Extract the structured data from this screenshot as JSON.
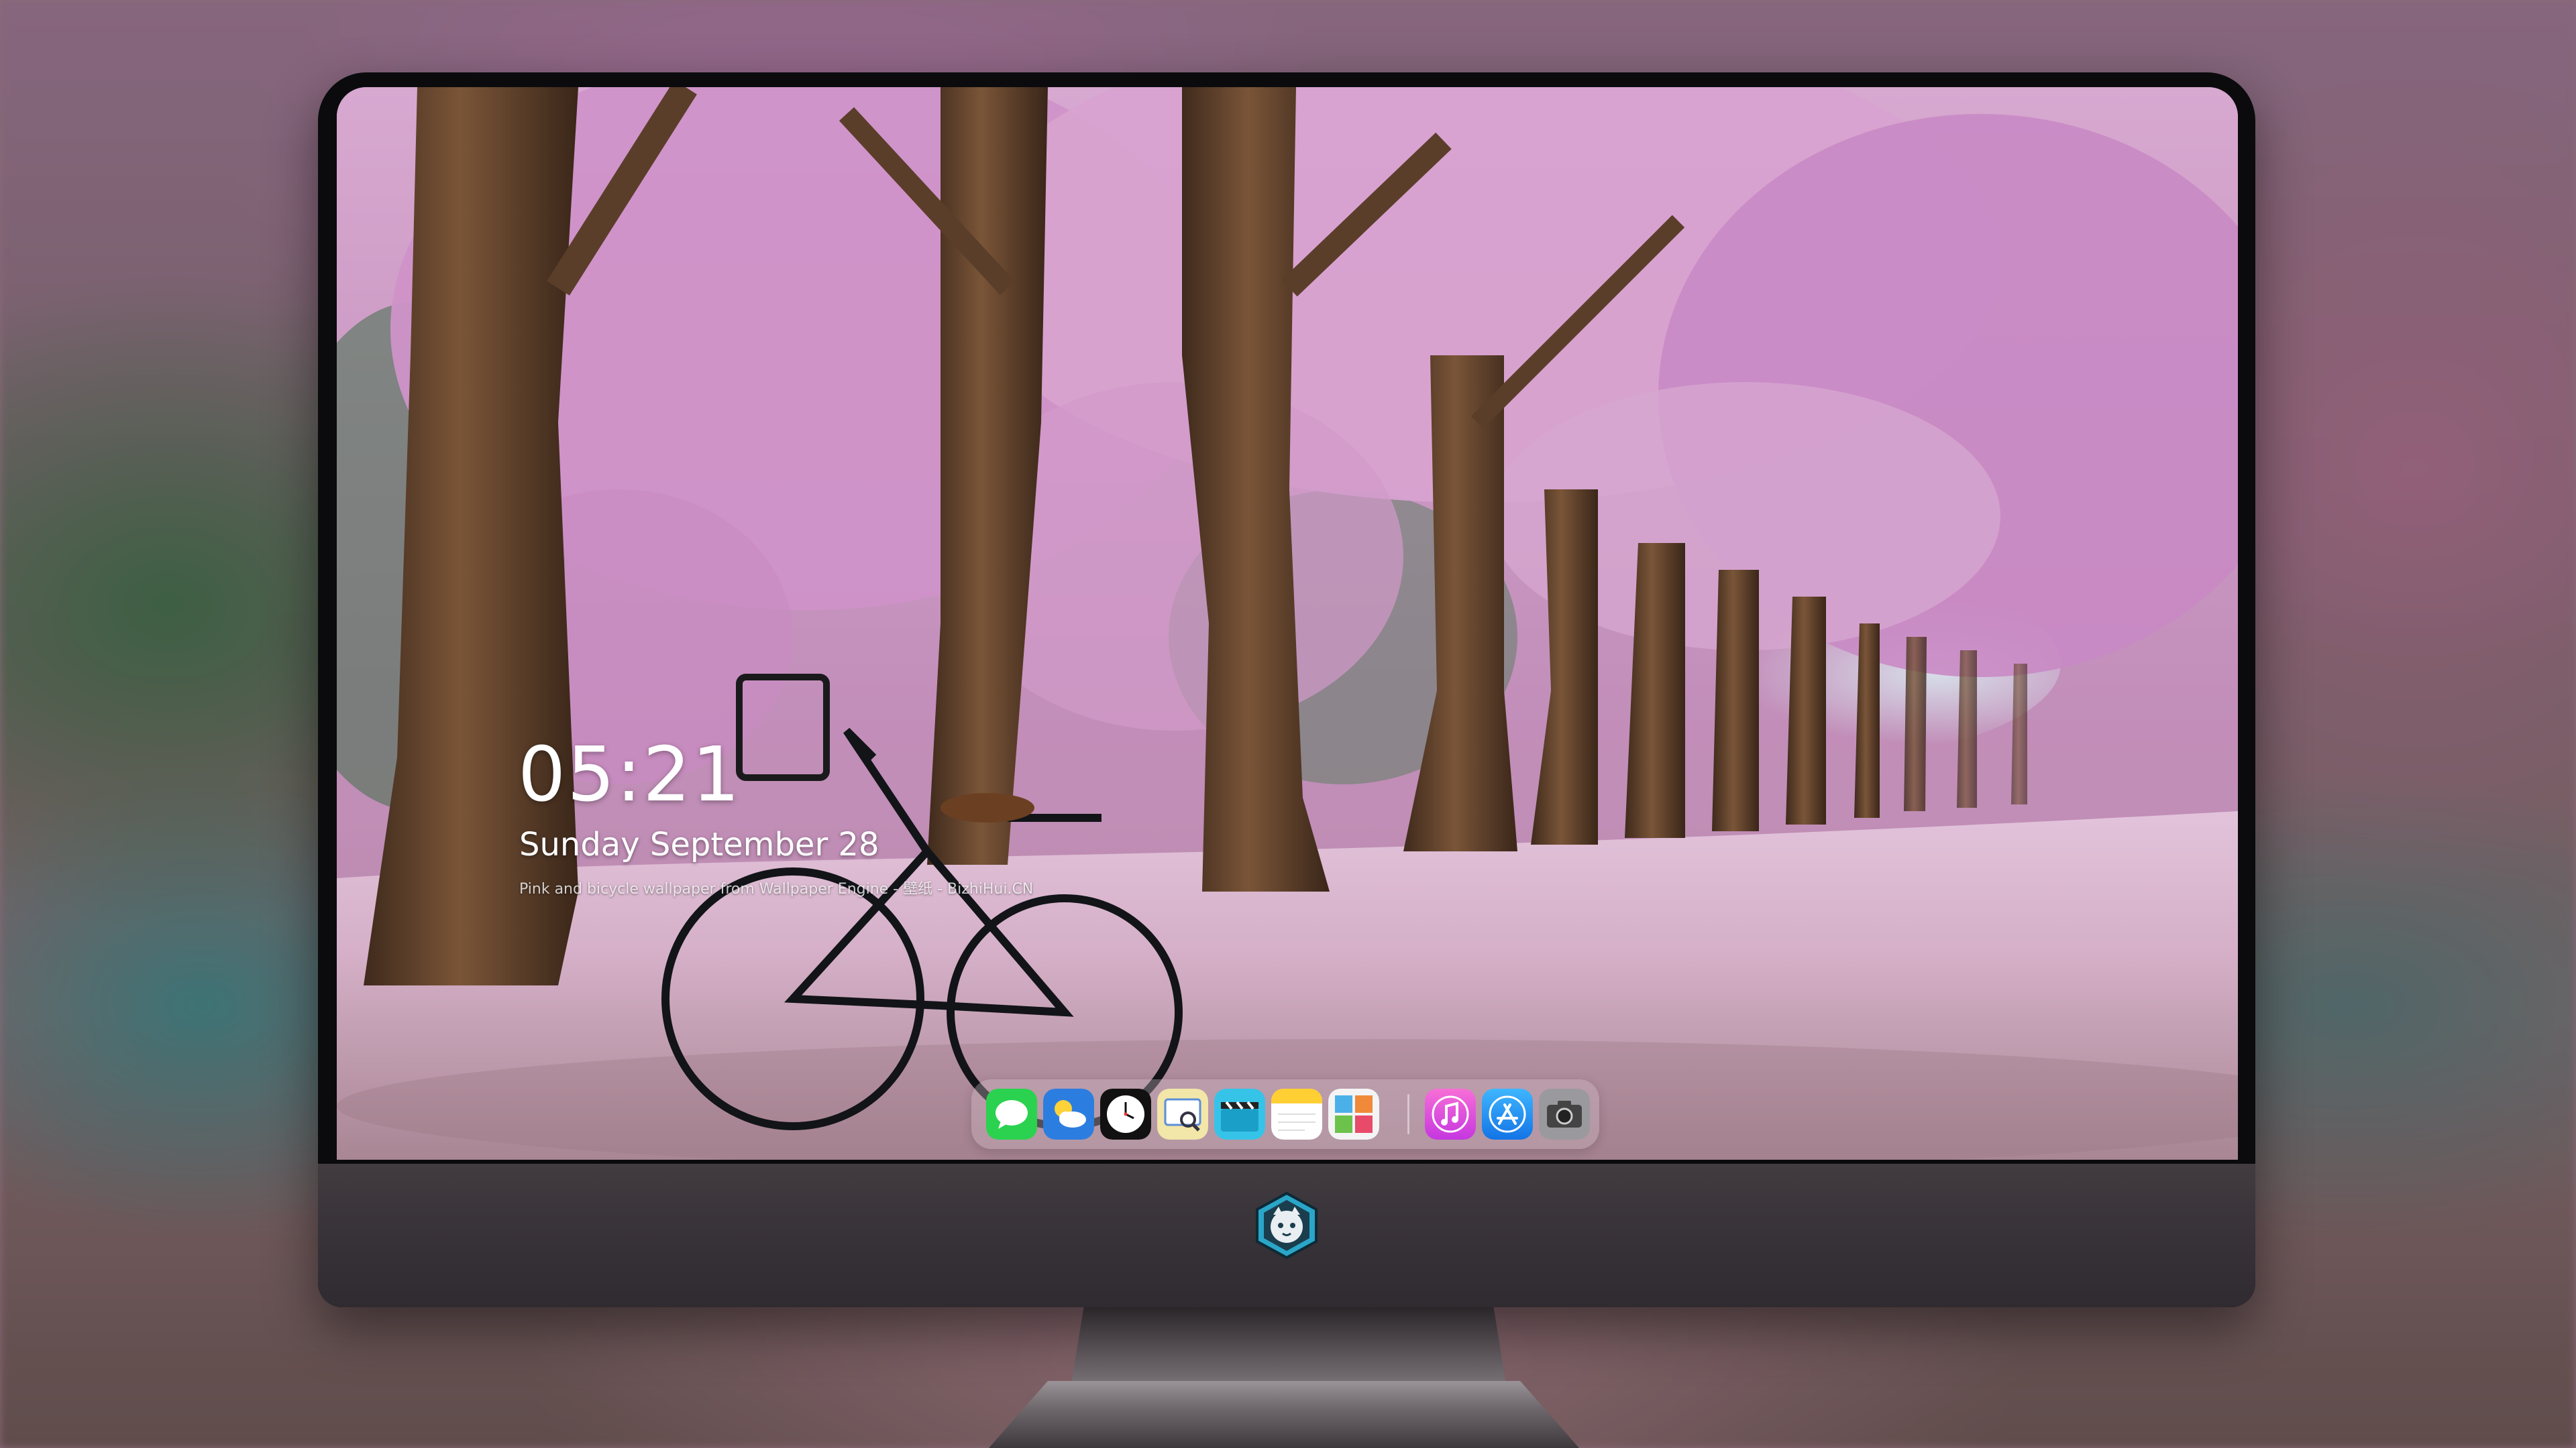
{
  "lock_screen": {
    "time": "05:21",
    "date": "Sunday September 28",
    "caption": "Pink and bicycle wallpaper from Wallpaper Engine - 壁纸 - BizhiHui.CN"
  },
  "dock": {
    "apps": [
      {
        "name": "Messages",
        "icon": "messages-icon"
      },
      {
        "name": "Weather",
        "icon": "weather-icon"
      },
      {
        "name": "Clock",
        "icon": "clock-icon"
      },
      {
        "name": "Preview",
        "icon": "preview-icon"
      },
      {
        "name": "Clips",
        "icon": "clips-icon"
      },
      {
        "name": "Notes",
        "icon": "notes-icon"
      },
      {
        "name": "Photo Booth",
        "icon": "photo-booth-icon"
      },
      {
        "name": "iTunes",
        "icon": "itunes-icon"
      },
      {
        "name": "App Store",
        "icon": "app-store-icon"
      },
      {
        "name": "Camera",
        "icon": "camera-icon"
      }
    ]
  },
  "colors": {
    "bezel": "#0b0b0e",
    "chin": "#39343a",
    "blossom": "#d9a0cf",
    "trunk": "#6b4a33"
  }
}
